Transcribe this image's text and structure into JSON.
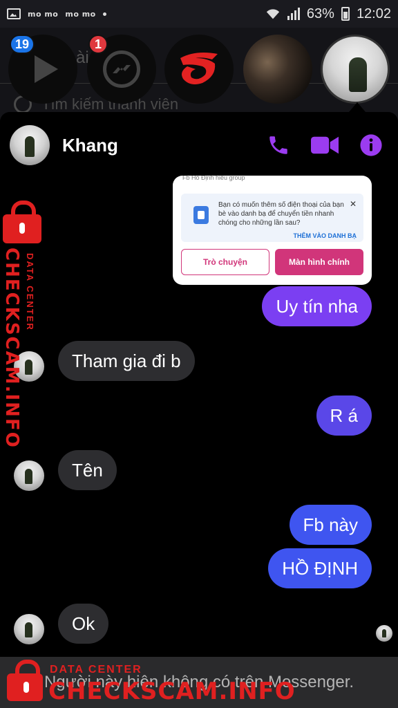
{
  "status_bar": {
    "momo_1": "mo mo",
    "momo_2": "mo mo",
    "battery_percent": "63%",
    "time": "12:02"
  },
  "background_list": {
    "partial_title": "ài",
    "search_placeholder": "Tìm kiếm thành viên"
  },
  "chat_heads": [
    {
      "icon": "play-icon",
      "badge": "19"
    },
    {
      "icon": "messenger-icon",
      "badge": "1"
    },
    {
      "icon": "garena-logo"
    },
    {
      "icon": "contact-photo"
    },
    {
      "icon": "khang-photo",
      "active": true
    }
  ],
  "chat": {
    "contact_name": "Khang",
    "actions": [
      "phone-icon",
      "video-call-icon",
      "info-icon"
    ],
    "accent_color": "#9b3cf0"
  },
  "shared_image": {
    "cut_text": "Fb Hồ Định hiểu group",
    "info_text": "Bạn có muốn thêm số điện thoại của bạn bè vào danh bạ để chuyển tiền nhanh chóng cho những lần sau?",
    "add_link": "THÊM VÀO DANH BẠ",
    "chat_button": "Trò chuyện",
    "home_button": "Màn hình chính"
  },
  "messages": [
    {
      "dir": "out",
      "text": "Uy tín nha"
    },
    {
      "dir": "in",
      "text": "Tham gia đi b"
    },
    {
      "dir": "out",
      "text": "R á"
    },
    {
      "dir": "in",
      "text": "Tên"
    },
    {
      "dir": "out",
      "text": "Fb này"
    },
    {
      "dir": "out",
      "text": "HỒ ĐỊNH"
    },
    {
      "dir": "in",
      "text": "Ok"
    }
  ],
  "notice": "Người này hiện không có trên Messenger.",
  "watermark": {
    "small": "DATA CENTER",
    "big": "CHECKSCAM.INFO"
  }
}
